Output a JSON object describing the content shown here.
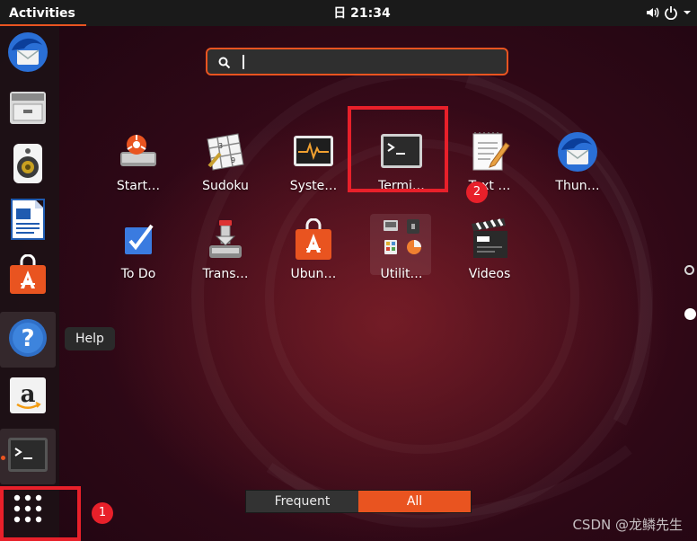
{
  "topbar": {
    "activities": "Activities",
    "clock": "日 21:34"
  },
  "dock": {
    "tooltip": "Help",
    "items": [
      {
        "name": "dock-thunderbird",
        "icon": "thunderbird-icon"
      },
      {
        "name": "dock-files",
        "icon": "file-cabinet-icon"
      },
      {
        "name": "dock-rhythmbox",
        "icon": "speaker-icon"
      },
      {
        "name": "dock-writer",
        "icon": "document-icon"
      },
      {
        "name": "dock-software",
        "icon": "shopping-bag-icon"
      },
      {
        "name": "dock-help",
        "icon": "help-icon"
      },
      {
        "name": "dock-amazon",
        "icon": "amazon-icon"
      },
      {
        "name": "dock-terminal",
        "icon": "terminal-icon"
      }
    ],
    "show_apps_icon": "app-grid-icon"
  },
  "search": {
    "value": "",
    "placeholder": ""
  },
  "apps": [
    {
      "label": "Start…",
      "icon": "startup-disk-icon"
    },
    {
      "label": "Sudoku",
      "icon": "sudoku-icon"
    },
    {
      "label": "Syste…",
      "icon": "system-monitor-icon"
    },
    {
      "label": "Termi…",
      "icon": "terminal-icon"
    },
    {
      "label": "Text …",
      "icon": "text-editor-icon"
    },
    {
      "label": "Thun…",
      "icon": "thunderbird-icon"
    },
    {
      "label": "To Do",
      "icon": "todo-icon"
    },
    {
      "label": "Trans…",
      "icon": "transmission-icon"
    },
    {
      "label": "Ubun…",
      "icon": "ubuntu-software-icon"
    },
    {
      "label": "Utilit…",
      "icon": "utilities-folder-icon"
    },
    {
      "label": "Videos",
      "icon": "videos-icon"
    }
  ],
  "annotations": {
    "badge1": "1",
    "badge2": "2"
  },
  "switcher": {
    "frequent": "Frequent",
    "all": "All"
  },
  "watermark": "CSDN @龙鳞先生",
  "colors": {
    "accent": "#e95420",
    "annotation": "#e8202a",
    "topbar": "#1a1a1a"
  }
}
